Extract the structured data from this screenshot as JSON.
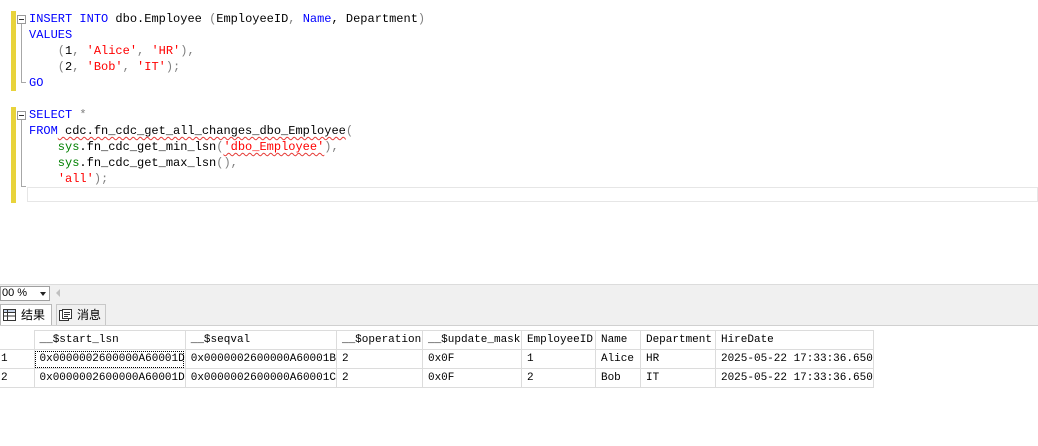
{
  "editor": {
    "lines": {
      "l1": {
        "a": "INSERT",
        "b": " ",
        "c": "INTO",
        "d": " dbo.Employee ",
        "e": "(",
        "f": "EmployeeID",
        "g": ", ",
        "h": "Name",
        "i": ", Department",
        "j": ")"
      },
      "l2": {
        "a": "VALUES"
      },
      "l3": {
        "a": "    (",
        "b": "1",
        "c": ", ",
        "d": "'Alice'",
        "e": ", ",
        "f": "'HR'",
        "g": "),"
      },
      "l4": {
        "a": "    (",
        "b": "2",
        "c": ", ",
        "d": "'Bob'",
        "e": ", ",
        "f": "'IT'",
        "g": ");"
      },
      "l5": {
        "a": "GO"
      },
      "l6": {
        "a": "SELECT",
        "b": " ",
        "c": "*"
      },
      "l7": {
        "a": "FROM",
        "b": " cdc.fn_cdc_get_all_changes_dbo_Employee",
        "c": "("
      },
      "l8": {
        "a": "    sys",
        "b": ".fn_cdc_get_min_lsn",
        "c": "(",
        "d": "'dbo_Employee'",
        "e": "),"
      },
      "l9": {
        "a": "    sys",
        "b": ".fn_cdc_get_max_lsn",
        "c": "(),"
      },
      "l10": {
        "a": "    ",
        "b": "'all'",
        "c": ");"
      }
    }
  },
  "zoom": {
    "value": "00 %"
  },
  "tabs": {
    "results_label": "结果",
    "messages_label": "消息"
  },
  "grid": {
    "columns": [
      "__$start_lsn",
      "__$seqval",
      "__$operation",
      "__$update_mask",
      "EmployeeID",
      "Name",
      "Department",
      "HireDate"
    ],
    "rows": [
      {
        "num": "1",
        "cells": [
          "0x0000002600000A60001D",
          "0x0000002600000A60001B",
          "2",
          "0x0F",
          "1",
          "Alice",
          "HR",
          "2025-05-22 17:33:36.650"
        ]
      },
      {
        "num": "2",
        "cells": [
          "0x0000002600000A60001D",
          "0x0000002600000A60001C",
          "2",
          "0x0F",
          "2",
          "Bob",
          "IT",
          "2025-05-22 17:33:36.650"
        ]
      }
    ]
  },
  "colors": {
    "keyword": "#0000ff",
    "system_function": "#ff00ff",
    "string": "#ff0000",
    "operator": "#808080",
    "sys_schema": "#008000",
    "changed_line_bar": "#e8d33b"
  }
}
